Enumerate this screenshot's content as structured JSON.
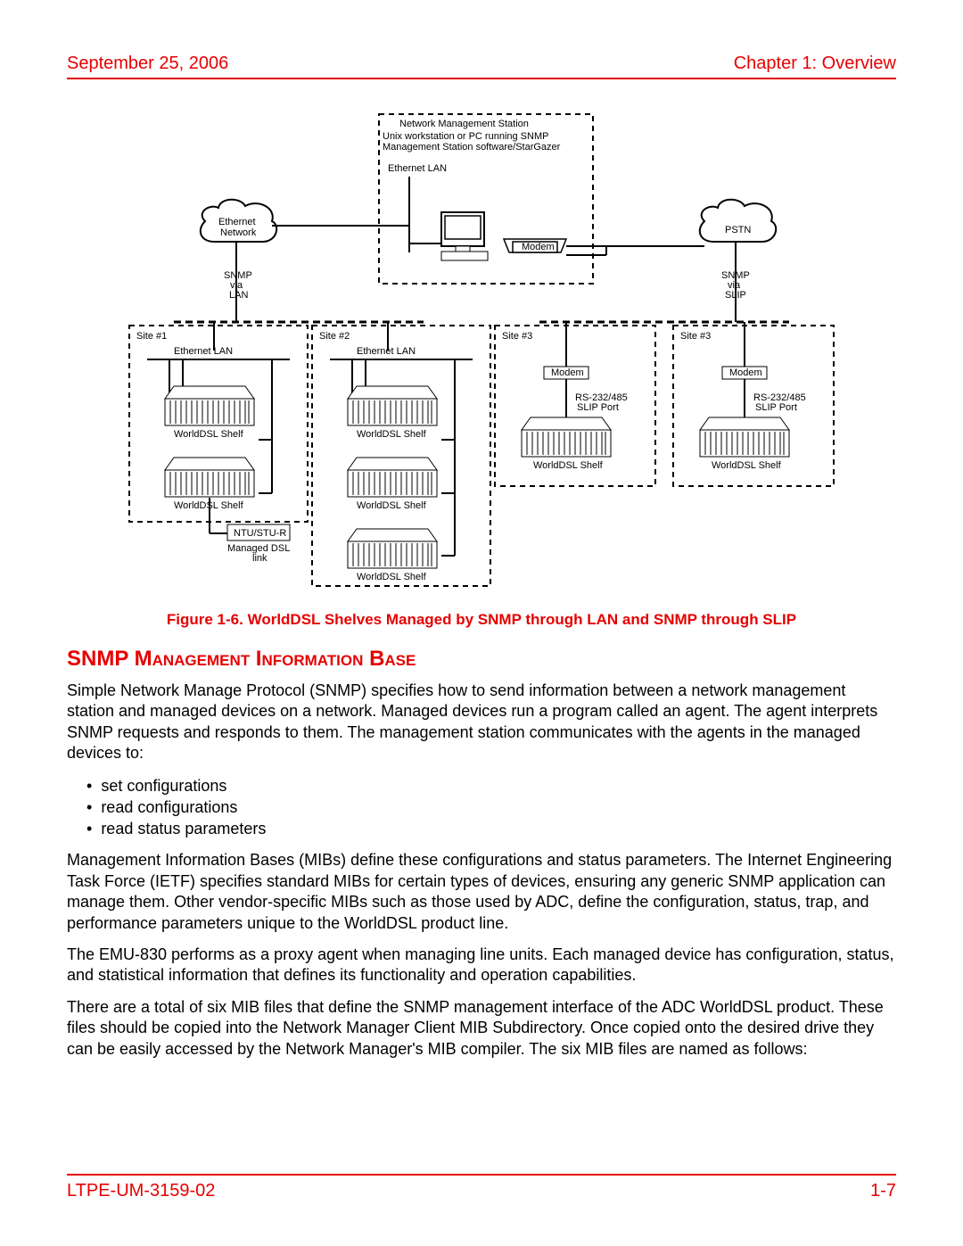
{
  "header": {
    "date": "September 25, 2006",
    "chapter": "Chapter 1: Overview"
  },
  "diagram": {
    "nms_title": "Network Management Station",
    "nms_sub1": "Unix workstation or PC running SNMP",
    "nms_sub2": "Management Station software/StarGazer",
    "ethernet_lan": "Ethernet LAN",
    "ethernet_network": "Ethernet",
    "ethernet_network2": "Network",
    "pstn": "PSTN",
    "modem": "Modem",
    "snmp": "SNMP",
    "via": "via",
    "lan": "LAN",
    "slip": "SLIP",
    "site1": "Site #1",
    "site2": "Site #2",
    "site3": "Site #3",
    "site4": "Site #3",
    "worlddsl_shelf": "WorldDSL Shelf",
    "rs232": "RS-232/485",
    "slip_port": "SLIP Port",
    "ntu": "NTU/STU-R",
    "managed_dsl": "Managed DSL",
    "link": "link"
  },
  "caption": "Figure 1-6. WorldDSL Shelves Managed by SNMP through LAN and SNMP through SLIP",
  "section_heading": "SNMP Management Information Base",
  "para1": "Simple Network Manage Protocol (SNMP) specifies how to send information between a network management station and managed devices on a network. Managed devices run a program called an agent. The agent interprets SNMP requests and responds to them. The management station communicates with the agents in the managed devices to:",
  "bullets": {
    "b1": "set configurations",
    "b2": "read configurations",
    "b3": "read status parameters"
  },
  "para2": "Management Information Bases (MIBs) define these configurations and status parameters. The Internet Engineering Task Force (IETF) specifies standard MIBs for certain types of devices, ensuring any generic SNMP application can manage them. Other vendor-specific MIBs such as those used by ADC, define the configuration, status, trap, and performance parameters unique to the WorldDSL product line.",
  "para3": "The EMU-830 performs as a proxy agent when managing line units. Each managed device has configuration, status, and statistical information that defines its functionality and operation capabilities.",
  "para4": "There are a total of six MIB files that define the SNMP management interface of the ADC WorldDSL product. These files should be copied into the Network Manager Client MIB Subdirectory. Once copied onto the desired drive they can be easily accessed by the Network Manager's MIB compiler. The six MIB files are named as follows:",
  "footer": {
    "docnum": "LTPE-UM-3159-02",
    "pagenum": "1-7"
  }
}
